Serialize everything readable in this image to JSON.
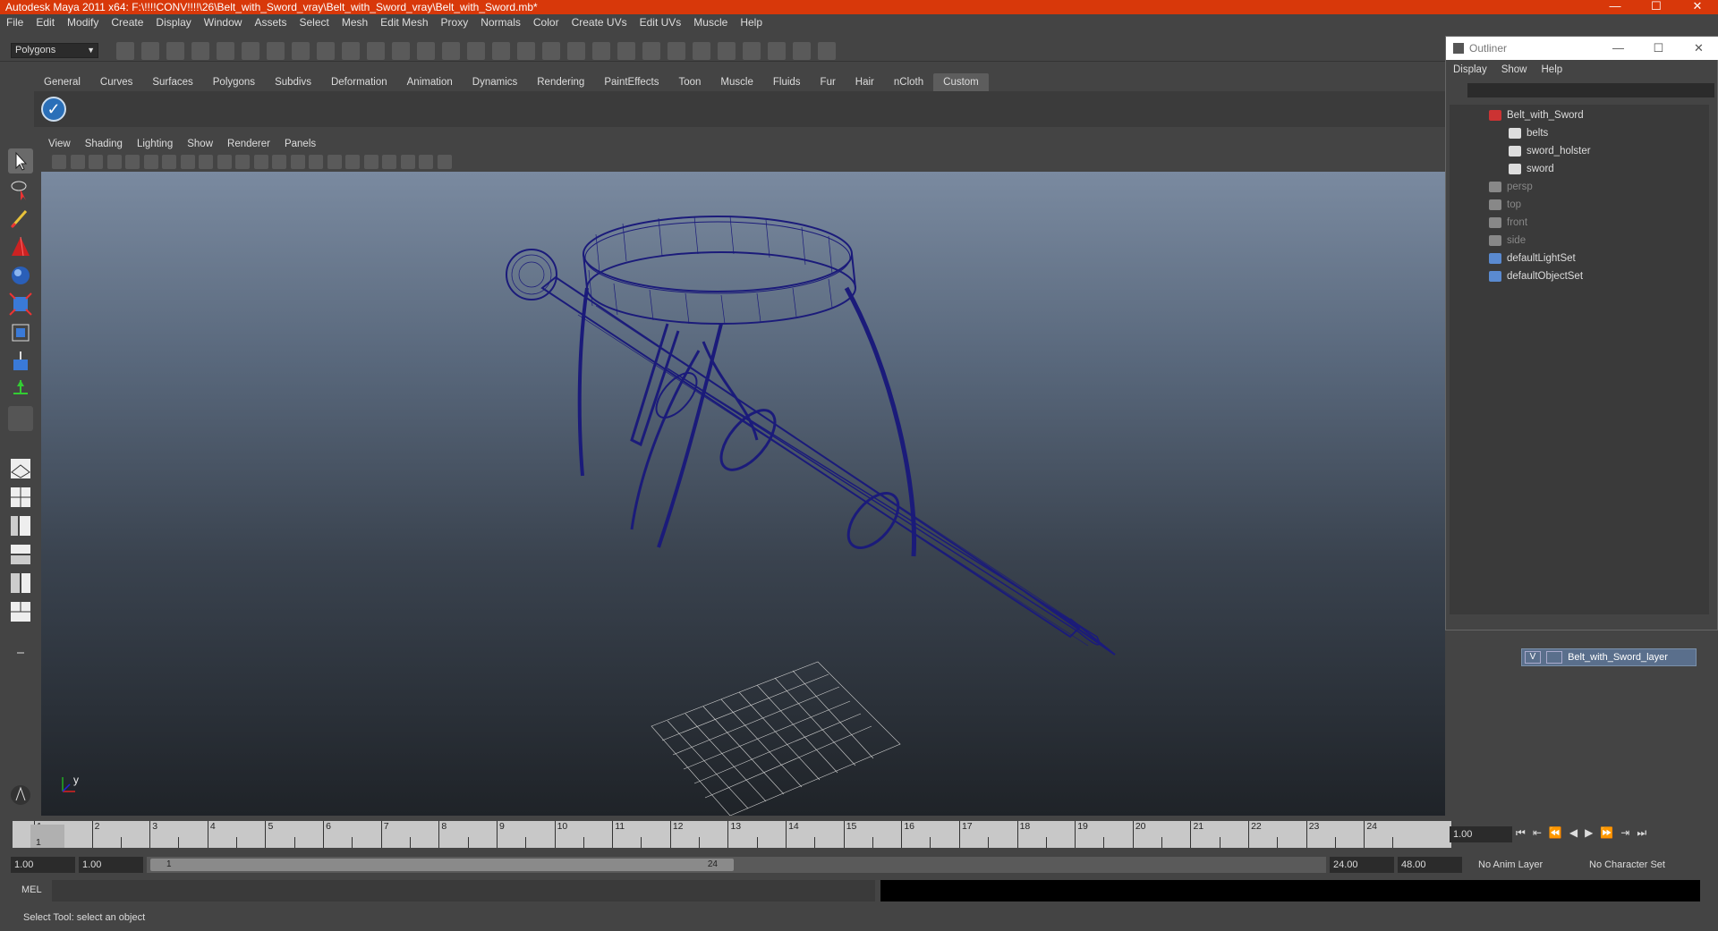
{
  "window": {
    "title": "Autodesk Maya 2011 x64: F:\\!!!!CONV!!!!\\26\\Belt_with_Sword_vray\\Belt_with_Sword_vray\\Belt_with_Sword.mb*",
    "min": "—",
    "max": "☐",
    "close": "✕"
  },
  "menubar": [
    "File",
    "Edit",
    "Modify",
    "Create",
    "Display",
    "Window",
    "Assets",
    "Select",
    "Mesh",
    "Edit Mesh",
    "Proxy",
    "Normals",
    "Color",
    "Create UVs",
    "Edit UVs",
    "Muscle",
    "Help"
  ],
  "statusline": {
    "mode": "Polygons"
  },
  "shelf": {
    "tabs": [
      "General",
      "Curves",
      "Surfaces",
      "Polygons",
      "Subdivs",
      "Deformation",
      "Animation",
      "Dynamics",
      "Rendering",
      "PaintEffects",
      "Toon",
      "Muscle",
      "Fluids",
      "Fur",
      "Hair",
      "nCloth",
      "Custom"
    ],
    "active_tab": "Custom"
  },
  "viewport": {
    "menu": [
      "View",
      "Shading",
      "Lighting",
      "Show",
      "Renderer",
      "Panels"
    ],
    "axis_label": "y"
  },
  "outliner": {
    "title": "Outliner",
    "menu": [
      "Display",
      "Show",
      "Help"
    ],
    "items": [
      {
        "label": "Belt_with_Sword",
        "indent": 0,
        "type": "group",
        "dim": false
      },
      {
        "label": "belts",
        "indent": 1,
        "type": "mesh",
        "dim": false
      },
      {
        "label": "sword_holster",
        "indent": 1,
        "type": "mesh",
        "dim": false
      },
      {
        "label": "sword",
        "indent": 1,
        "type": "mesh",
        "dim": false
      },
      {
        "label": "persp",
        "indent": 0,
        "type": "camera",
        "dim": true
      },
      {
        "label": "top",
        "indent": 0,
        "type": "camera",
        "dim": true
      },
      {
        "label": "front",
        "indent": 0,
        "type": "camera",
        "dim": true
      },
      {
        "label": "side",
        "indent": 0,
        "type": "camera",
        "dim": true
      },
      {
        "label": "defaultLightSet",
        "indent": 0,
        "type": "set",
        "dim": false
      },
      {
        "label": "defaultObjectSet",
        "indent": 0,
        "type": "set",
        "dim": false
      }
    ]
  },
  "layers": {
    "visible": "V",
    "name": "Belt_with_Sword_layer"
  },
  "timeline": {
    "frames": [
      "1",
      "2",
      "3",
      "4",
      "5",
      "6",
      "7",
      "8",
      "9",
      "10",
      "11",
      "12",
      "13",
      "14",
      "15",
      "16",
      "17",
      "18",
      "19",
      "20",
      "21",
      "22",
      "23",
      "24"
    ],
    "current_marker": "1",
    "current_frame": "1.00",
    "play_icons": [
      "⏮",
      "⇤",
      "⏪",
      "◀",
      "▶",
      "⏩",
      "⇥",
      "⏭"
    ]
  },
  "range": {
    "start": "1.00",
    "playback_start": "1.00",
    "handle_start": "1",
    "handle_end": "24",
    "playback_end": "24.00",
    "end": "48.00",
    "anim_layer": "No Anim Layer",
    "char_set": "No Character Set"
  },
  "cmd": {
    "label": "MEL"
  },
  "help": {
    "text": "Select Tool: select an object"
  }
}
